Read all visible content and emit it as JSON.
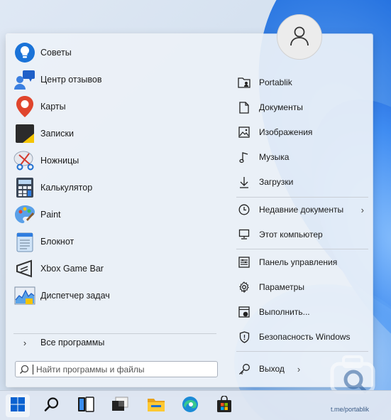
{
  "start_menu": {
    "apps": [
      {
        "label": "Советы",
        "icon": "tips-icon"
      },
      {
        "label": "Центр отзывов",
        "icon": "feedback-hub-icon"
      },
      {
        "label": "Карты",
        "icon": "maps-icon"
      },
      {
        "label": "Записки",
        "icon": "sticky-notes-icon"
      },
      {
        "label": "Ножницы",
        "icon": "snipping-tool-icon"
      },
      {
        "label": "Калькулятор",
        "icon": "calculator-icon"
      },
      {
        "label": "Paint",
        "icon": "paint-icon"
      },
      {
        "label": "Блокнот",
        "icon": "notepad-icon"
      },
      {
        "label": "Xbox Game Bar",
        "icon": "xbox-game-bar-icon"
      },
      {
        "label": "Диспетчер задач",
        "icon": "task-manager-icon"
      }
    ],
    "all_programs_label": "Все программы",
    "search_placeholder": "Найти программы и файлы",
    "right_items": [
      {
        "label": "Portablik",
        "icon": "user-folder-icon"
      },
      {
        "label": "Документы",
        "icon": "documents-icon"
      },
      {
        "label": "Изображения",
        "icon": "pictures-icon"
      },
      {
        "label": "Музыка",
        "icon": "music-icon"
      },
      {
        "label": "Загрузки",
        "icon": "downloads-icon"
      },
      {
        "label": "Недавние документы",
        "icon": "recent-icon"
      },
      {
        "label": "Этот компьютер",
        "icon": "computer-icon"
      },
      {
        "label": "Панель управления",
        "icon": "control-panel-icon"
      },
      {
        "label": "Параметры",
        "icon": "settings-gear-icon"
      },
      {
        "label": "Выполнить...",
        "icon": "run-icon"
      },
      {
        "label": "Безопасность Windows",
        "icon": "shield-icon"
      },
      {
        "label": "Выход",
        "icon": "key-icon"
      }
    ],
    "user_avatar_icon": "user-avatar-icon"
  },
  "taskbar": {
    "buttons": [
      {
        "name": "start",
        "icon": "windows-start-icon"
      },
      {
        "name": "search",
        "icon": "search-icon"
      },
      {
        "name": "task-view",
        "icon": "task-view-icon"
      },
      {
        "name": "desktop",
        "icon": "desktop-icon"
      },
      {
        "name": "file-explorer",
        "icon": "folder-icon"
      },
      {
        "name": "edge",
        "icon": "edge-icon"
      },
      {
        "name": "store",
        "icon": "store-icon"
      }
    ]
  },
  "watermark": {
    "text": "t.me/portablik"
  },
  "colors": {
    "accent": "#0a62d0",
    "menu_bg": "#eceff5",
    "text": "#1b1b1b"
  }
}
